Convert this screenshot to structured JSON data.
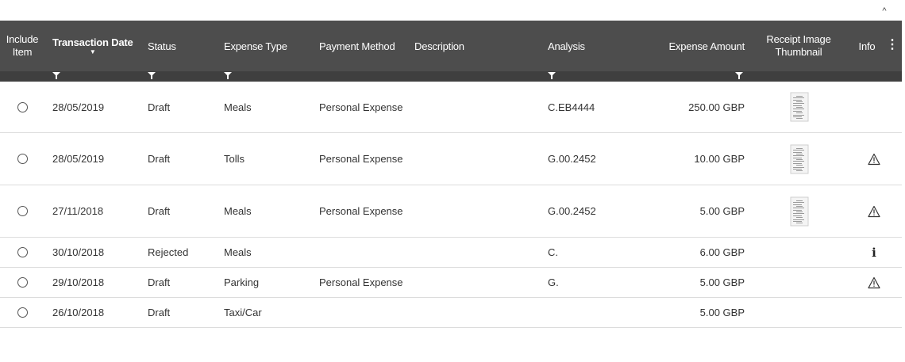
{
  "header": {
    "collapse_icon": "^",
    "columns": {
      "include_item": "Include Item",
      "transaction_date": "Transaction Date",
      "status": "Status",
      "expense_type": "Expense Type",
      "payment_method": "Payment Method",
      "description": "Description",
      "analysis": "Analysis",
      "expense_amount": "Expense Amount",
      "receipt_thumbnail": "Receipt Image Thumbnail",
      "info": "Info"
    },
    "sort_indicator": "▼",
    "menu_icon": "⋮"
  },
  "rows": [
    {
      "date": "28/05/2019",
      "status": "Draft",
      "type": "Meals",
      "payment": "Personal Expense",
      "description": "",
      "analysis": "C.EB4444",
      "amount": "250.00 GBP",
      "receipt": true,
      "info": ""
    },
    {
      "date": "28/05/2019",
      "status": "Draft",
      "type": "Tolls",
      "payment": "Personal Expense",
      "description": "",
      "analysis": "G.00.2452",
      "amount": "10.00 GBP",
      "receipt": true,
      "info": "warning"
    },
    {
      "date": "27/11/2018",
      "status": "Draft",
      "type": "Meals",
      "payment": "Personal Expense",
      "description": "",
      "analysis": "G.00.2452",
      "amount": "5.00 GBP",
      "receipt": true,
      "info": "warning"
    },
    {
      "date": "30/10/2018",
      "status": "Rejected",
      "type": "Meals",
      "payment": "",
      "description": "",
      "analysis": "C.",
      "amount": "6.00 GBP",
      "receipt": false,
      "info": "i"
    },
    {
      "date": "29/10/2018",
      "status": "Draft",
      "type": "Parking",
      "payment": "Personal Expense",
      "description": "",
      "analysis": "G.",
      "amount": "5.00 GBP",
      "receipt": false,
      "info": "warning"
    },
    {
      "date": "26/10/2018",
      "status": "Draft",
      "type": "Taxi/Car",
      "payment": "",
      "description": "",
      "analysis": "",
      "amount": "5.00 GBP",
      "receipt": false,
      "info": ""
    }
  ]
}
